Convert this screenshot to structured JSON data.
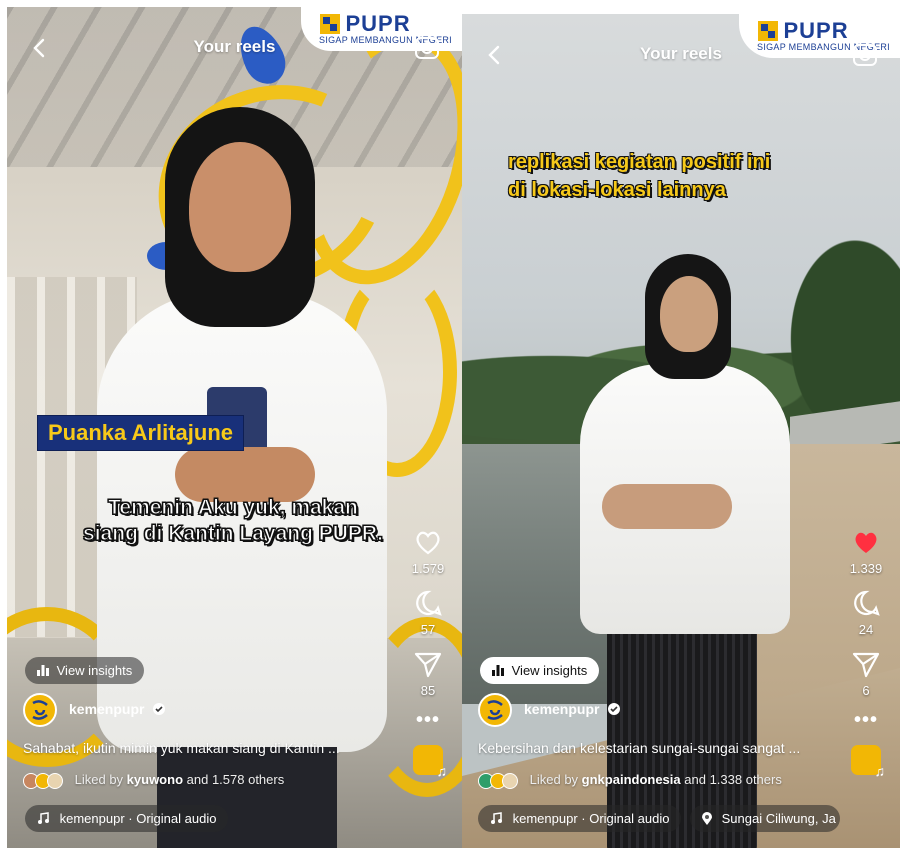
{
  "left": {
    "header": {
      "title": "Your reels"
    },
    "logo": {
      "text_main": "PUPR",
      "text_sub": "SIGAP MEMBANGUN NEGERI"
    },
    "name_tag": "Puanka Arlitajune",
    "caption_lines": [
      "Temenin Aku yuk, makan",
      "siang di Kantin Layang PUPR."
    ],
    "actions": {
      "likes": "1.579",
      "comments": "57",
      "shares": "85"
    },
    "insights_label": "View insights",
    "username": "kemenpupr",
    "description": "Sahabat, ikutin mimin yuk makan siang di Kantin ...",
    "liked_by": {
      "prefix": "Liked by",
      "user": "kyuwono",
      "suffix": "and 1.578 others"
    },
    "audio": "kemenpupr · Original audio"
  },
  "right": {
    "header": {
      "title": "Your reels"
    },
    "logo": {
      "text_main": "PUPR",
      "text_sub": "SIGAP MEMBANGUN NEGERI"
    },
    "caption_lines": [
      "replikasi kegiatan positif ini",
      "di lokasi-lokasi lainnya"
    ],
    "actions": {
      "likes": "1.339",
      "comments": "24",
      "shares": "6"
    },
    "insights_label": "View insights",
    "username": "kemenpupr",
    "description": "Kebersihan dan kelestarian sungai-sungai sangat ...",
    "liked_by": {
      "prefix": "Liked by",
      "user": "gnkpaindonesia",
      "suffix": "and 1.338 others"
    },
    "audio": "kemenpupr · Original audio",
    "location": "Sungai Ciliwung, Ja"
  },
  "colors": {
    "like_active": "#ff3040",
    "brand_yellow": "#f2b705",
    "brand_blue": "#1c3f95"
  }
}
